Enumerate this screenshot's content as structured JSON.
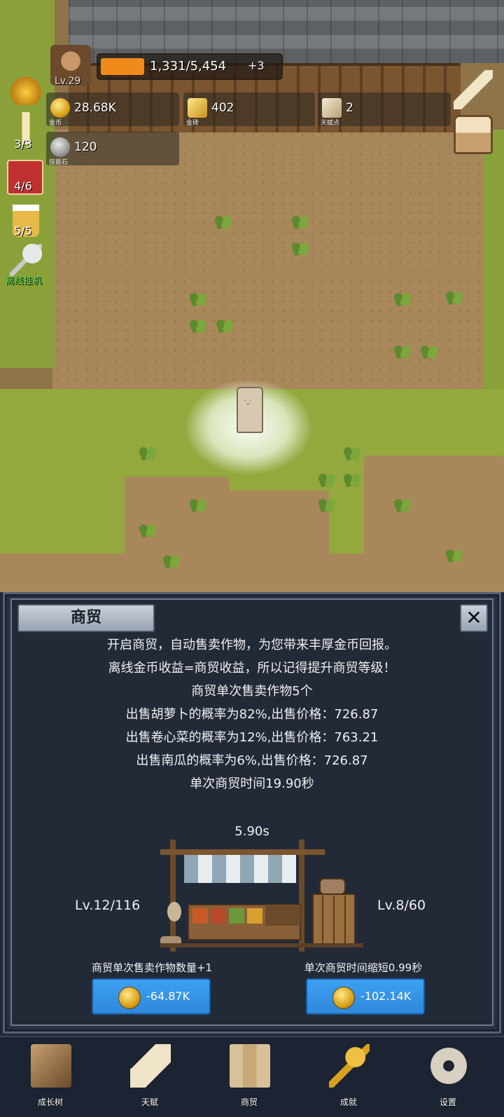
{
  "hud": {
    "level": "Lv.29",
    "exp_text": "1,331/5,454",
    "exp_bonus": "+3",
    "exp_progress": 0.244,
    "resources": [
      {
        "value": "28.68K",
        "label": "金币",
        "icon": "gold-coin-icon"
      },
      {
        "value": "402",
        "label": "金砖",
        "icon": "gold-bar-icon"
      },
      {
        "value": "2",
        "label": "天赋点",
        "icon": "talent-scroll-icon"
      },
      {
        "value": "120",
        "label": "技能石",
        "icon": "skill-stone-icon"
      }
    ],
    "side": {
      "candle_count": "3/3",
      "dice_count": "4/6",
      "drink_count": "5/5",
      "auto_label": "离线挂机"
    }
  },
  "panel": {
    "title": "商贸",
    "close_label": "✕",
    "description": [
      "开启商贸，自动售卖作物，为您带来丰厚金币回报。",
      "离线金币收益=商贸收益，所以记得提升商贸等级！",
      "商贸单次售卖作物5个",
      "出售胡萝卜的概率为82%,出售价格：726.87",
      "出售卷心菜的概率为12%,出售价格：763.21",
      "出售南瓜的概率为6%,出售价格：726.87",
      "单次商贸时间19.90秒"
    ],
    "timer": "5.90s",
    "left_level": "Lv.12/116",
    "right_level": "Lv.8/60",
    "upgrades": [
      {
        "label": "商贸单次售卖作物数量+1",
        "cost": "-64.87K"
      },
      {
        "label": "单次商贸时间缩短0.99秒",
        "cost": "-102.14K"
      }
    ]
  },
  "nav": [
    {
      "label": "成长树",
      "icon": "book-icon"
    },
    {
      "label": "天赋",
      "icon": "scroll-icon"
    },
    {
      "label": "商贸",
      "icon": "map-icon"
    },
    {
      "label": "成就",
      "icon": "key-icon"
    },
    {
      "label": "设置",
      "icon": "gear-icon"
    }
  ]
}
